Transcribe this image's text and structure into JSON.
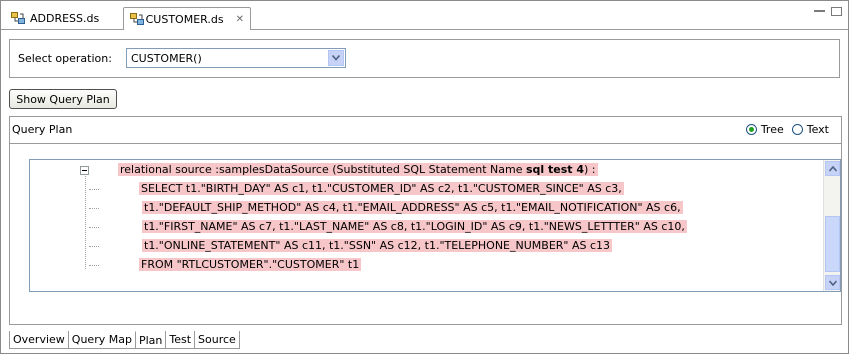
{
  "tabs": [
    {
      "label": "ADDRESS.ds",
      "icon": "datasource-icon",
      "active": false
    },
    {
      "label": "CUSTOMER.ds",
      "icon": "datasource-icon",
      "active": true,
      "close_glyph": "✕"
    }
  ],
  "operation": {
    "label": "Select operation:",
    "selected": "CUSTOMER()"
  },
  "show_query_plan_button": "Show Query Plan",
  "query_plan": {
    "title": "Query Plan",
    "view_options": [
      {
        "label": "Tree",
        "selected": true
      },
      {
        "label": "Text",
        "selected": false
      }
    ],
    "root_prefix": "relational source :samplesDataSource (Substituted SQL Statement Name ",
    "root_bold": "sql test 4",
    "root_suffix": ") :",
    "children": [
      "SELECT t1.\"BIRTH_DAY\" AS c1, t1.\"CUSTOMER_ID\" AS c2, t1.\"CUSTOMER_SINCE\" AS c3,",
      "t1.\"DEFAULT_SHIP_METHOD\" AS c4, t1.\"EMAIL_ADDRESS\" AS c5, t1.\"EMAIL_NOTIFICATION\" AS c6,",
      "t1.\"FIRST_NAME\" AS c7, t1.\"LAST_NAME\" AS c8, t1.\"LOGIN_ID\" AS c9, t1.\"NEWS_LETTTER\" AS c10,",
      "t1.\"ONLINE_STATEMENT\" AS c11, t1.\"SSN\" AS c12, t1.\"TELEPHONE_NUMBER\" AS c13",
      "FROM \"RTLCUSTOMER\".\"CUSTOMER\" t1"
    ],
    "highlight_color": "#f6c6c8"
  },
  "bottom_tabs": [
    "Overview",
    "Query Map",
    "Plan",
    "Test",
    "Source"
  ],
  "active_bottom_tab": "Plan"
}
